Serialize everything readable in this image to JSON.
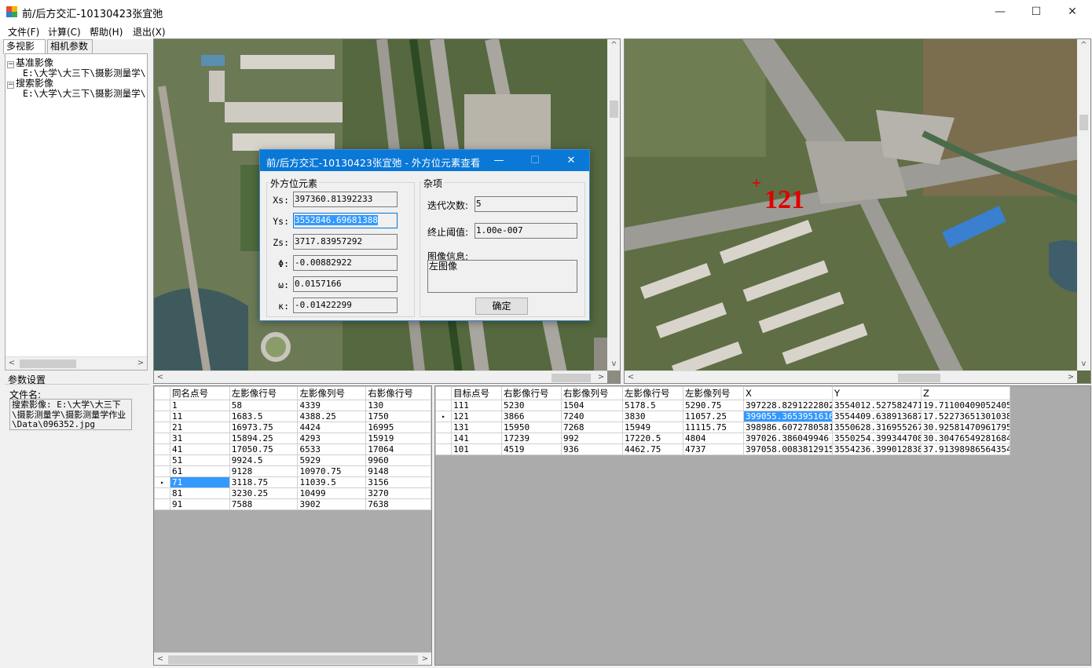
{
  "window": {
    "title": "前/后方交汇-10130423张宜弛",
    "minimize": "—",
    "maximize": "☐",
    "close": "✕"
  },
  "menu": [
    "文件(F)",
    "计算(C)",
    "帮助(H)",
    "退出(X)"
  ],
  "left_tabs": [
    "多视影像",
    "相机参数"
  ],
  "tree": {
    "node1": "基准影像",
    "node1_child": "E:\\大学\\大三下\\摄影测量学\\",
    "node2": "搜索影像",
    "node2_child": "E:\\大学\\大三下\\摄影测量学\\"
  },
  "params": {
    "title": "参数设置",
    "file_label": "文件名:",
    "file_value": "搜索影像: E:\\大学\\大三下\\摄影测量学\\摄影测量学作业\\Data\\096352.jpg"
  },
  "right_image": {
    "point_label": "121"
  },
  "dialog": {
    "title": "前/后方交汇-10130423张宜弛 - 外方位元素查看",
    "group1": "外方位元素",
    "fields": [
      {
        "label": "Xs:",
        "value": "397360.81392233"
      },
      {
        "label": "Ys:",
        "value": "3552846.69681388"
      },
      {
        "label": "Zs:",
        "value": "3717.83957292"
      },
      {
        "label": "Φ:",
        "value": "-0.00882922"
      },
      {
        "label": "ω:",
        "value": "0.0157166"
      },
      {
        "label": "κ:",
        "value": "-0.01422299"
      }
    ],
    "group2": "杂项",
    "iter_label": "迭代次数:",
    "iter_value": "5",
    "thresh_label": "终止阈值:",
    "thresh_value": "1.00e-007",
    "info_label": "图像信息:",
    "info_value": "左图像",
    "ok": "确定"
  },
  "grid_left": {
    "headers": [
      "同名点号",
      "左影像行号",
      "左影像列号",
      "右影像行号"
    ],
    "rows": [
      [
        "1",
        "58",
        "4339",
        "130"
      ],
      [
        "11",
        "1683.5",
        "4388.25",
        "1750"
      ],
      [
        "21",
        "16973.75",
        "4424",
        "16995"
      ],
      [
        "31",
        "15894.25",
        "4293",
        "15919"
      ],
      [
        "41",
        "17050.75",
        "6533",
        "17064"
      ],
      [
        "51",
        "9924.5",
        "5929",
        "9960"
      ],
      [
        "61",
        "9128",
        "10970.75",
        "9148"
      ],
      [
        "71",
        "3118.75",
        "11039.5",
        "3156"
      ],
      [
        "81",
        "3230.25",
        "10499",
        "3270"
      ],
      [
        "91",
        "7588",
        "3902",
        "7638"
      ]
    ],
    "selected_row": 7
  },
  "grid_right": {
    "headers": [
      "目标点号",
      "右影像行号",
      "右影像列号",
      "左影像行号",
      "左影像列号",
      "X",
      "Y",
      "Z"
    ],
    "rows": [
      [
        "111",
        "5230",
        "1504",
        "5178.5",
        "5290.75",
        "397228.82912228024",
        "3554012.5275824713",
        "19.711004090524057"
      ],
      [
        "121",
        "3866",
        "7240",
        "3830",
        "11057.25",
        "399055.36539516161",
        "3554409.6389136878",
        "17.522736513010386"
      ],
      [
        "131",
        "15950",
        "7268",
        "15949",
        "11115.75",
        "398986.60727805813",
        "3550628.3169552675",
        "30.925814709617953"
      ],
      [
        "141",
        "17239",
        "992",
        "17220.5",
        "4804",
        "397026.386049946",
        "3550254.3993447088",
        "30.304765492816841"
      ],
      [
        "101",
        "4519",
        "936",
        "4462.75",
        "4737",
        "397058.00838129153",
        "3554236.399012838",
        "37.913989865643543"
      ]
    ],
    "selected_row": 1
  },
  "colors": {
    "dialog_title": "#0a78d7",
    "selection": "#3399ff",
    "point_label": "#e00000"
  }
}
